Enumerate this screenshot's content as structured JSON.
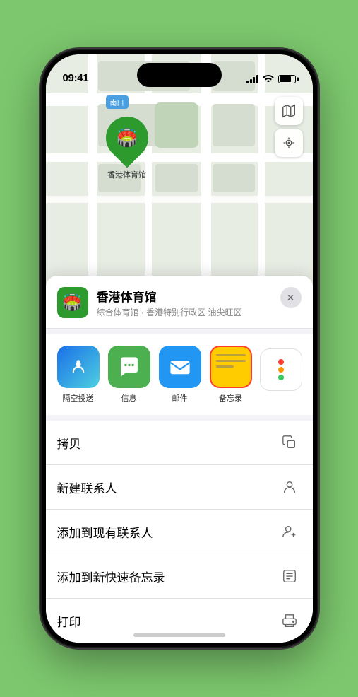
{
  "statusBar": {
    "time": "09:41",
    "locationArrow": "▶"
  },
  "dynamicIsland": {},
  "map": {
    "locationLabel": "南口",
    "pinLabel": "香港体育馆"
  },
  "placeHeader": {
    "name": "香港体育馆",
    "subtitle": "综合体育馆 · 香港特别行政区 油尖旺区",
    "closeLabel": "✕"
  },
  "shareItems": [
    {
      "id": "airdrop",
      "label": "隔空投送",
      "type": "airdrop"
    },
    {
      "id": "message",
      "label": "信息",
      "type": "message"
    },
    {
      "id": "mail",
      "label": "邮件",
      "type": "mail"
    },
    {
      "id": "notes",
      "label": "备忘录",
      "type": "notes"
    }
  ],
  "moreColors": [
    "#ff3b30",
    "#ff9500",
    "#34c759"
  ],
  "actionItems": [
    {
      "id": "copy",
      "label": "拷贝",
      "icon": "copy"
    },
    {
      "id": "new-contact",
      "label": "新建联系人",
      "icon": "person-add"
    },
    {
      "id": "add-existing",
      "label": "添加到现有联系人",
      "icon": "person-badge-plus"
    },
    {
      "id": "quick-note",
      "label": "添加到新快速备忘录",
      "icon": "note-text"
    },
    {
      "id": "print",
      "label": "打印",
      "icon": "printer"
    }
  ]
}
